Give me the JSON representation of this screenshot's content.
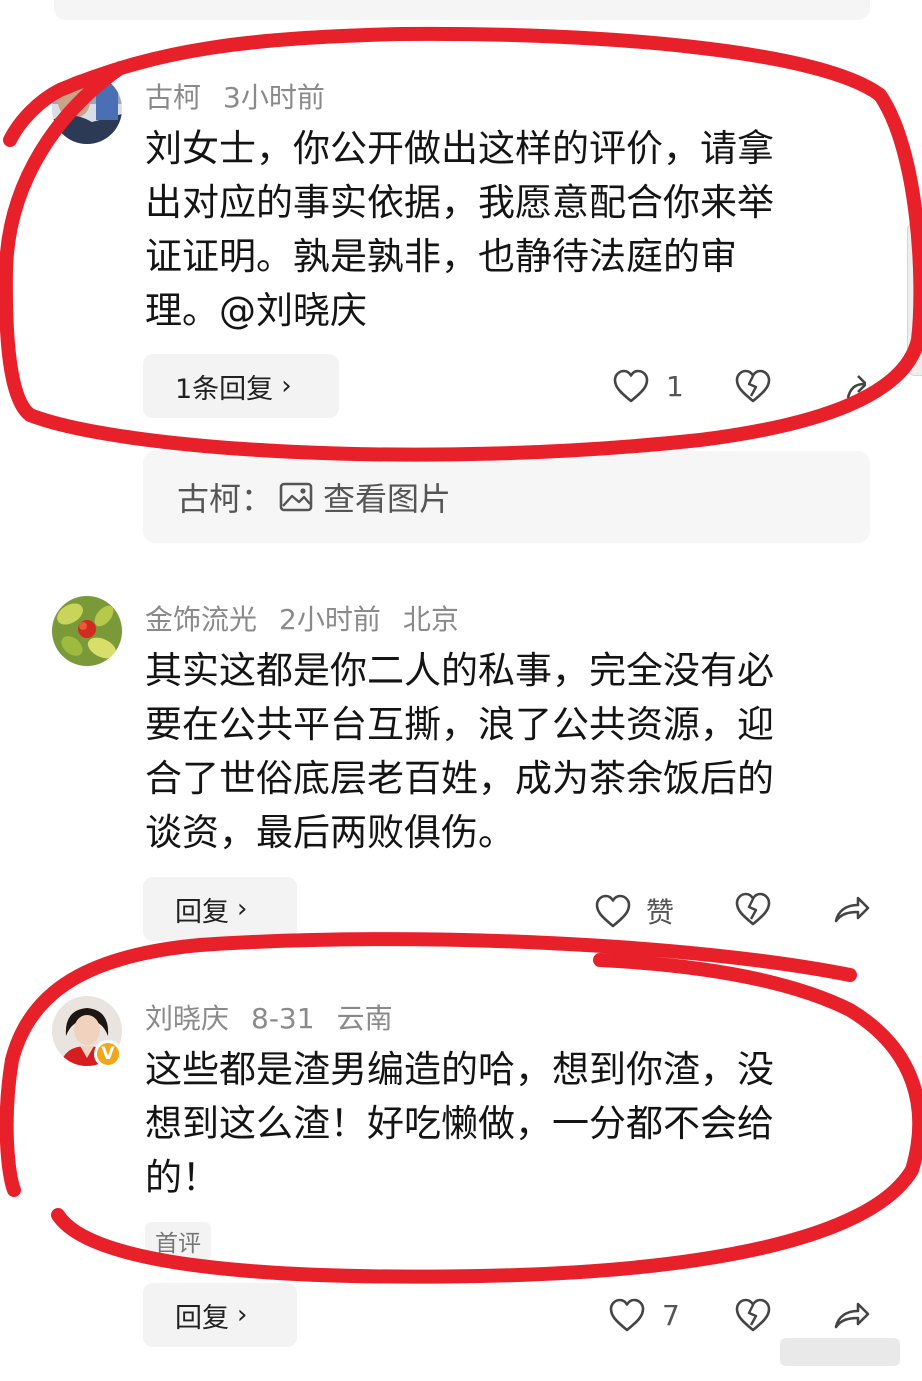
{
  "comments": [
    {
      "user": "古柯",
      "time": "3小时前",
      "location": "",
      "text": "刘女士，你公开做出这样的评价，请拿出对应的事实依据，我愿意配合你来举证证明。孰是孰非，也静待法庭的审理。@刘晓庆",
      "lines": [
        "刘女士，你公开做出这样的评价，请拿",
        "出对应的事实依据，我愿意配合你来举",
        "证证明。孰是孰非，也静待法庭的审",
        "理。@刘晓庆"
      ],
      "reply_label": "1条回复",
      "like_label": "1",
      "nested_reply": {
        "user": "古柯：",
        "content": "查看图片"
      }
    },
    {
      "user": "金饰流光",
      "time": "2小时前",
      "location": "北京",
      "lines": [
        "其实这都是你二人的私事，完全没有必",
        "要在公共平台互撕，浪了公共资源，迎",
        "合了世俗底层老百姓，成为茶余饭后的",
        "谈资，最后两败俱伤。"
      ],
      "reply_label": "回复",
      "like_label": "赞"
    },
    {
      "user": "刘晓庆",
      "time": "8-31",
      "location": "云南",
      "lines": [
        "这些都是渣男编造的哈，想到你渣，没",
        "想到这么渣！好吃懒做，一分都不会给",
        "的！"
      ],
      "badge": "首评",
      "verified": "V",
      "reply_label": "回复",
      "like_label": "7"
    }
  ],
  "colors": {
    "annotation": "#e8202a",
    "meta": "#8a8a8a",
    "text": "#141414",
    "button_bg": "#f3f3f3",
    "verified": "#f2a71b"
  },
  "icons": [
    "heart-icon",
    "broken-heart-icon",
    "share-icon",
    "chevron-right-icon",
    "image-icon"
  ]
}
